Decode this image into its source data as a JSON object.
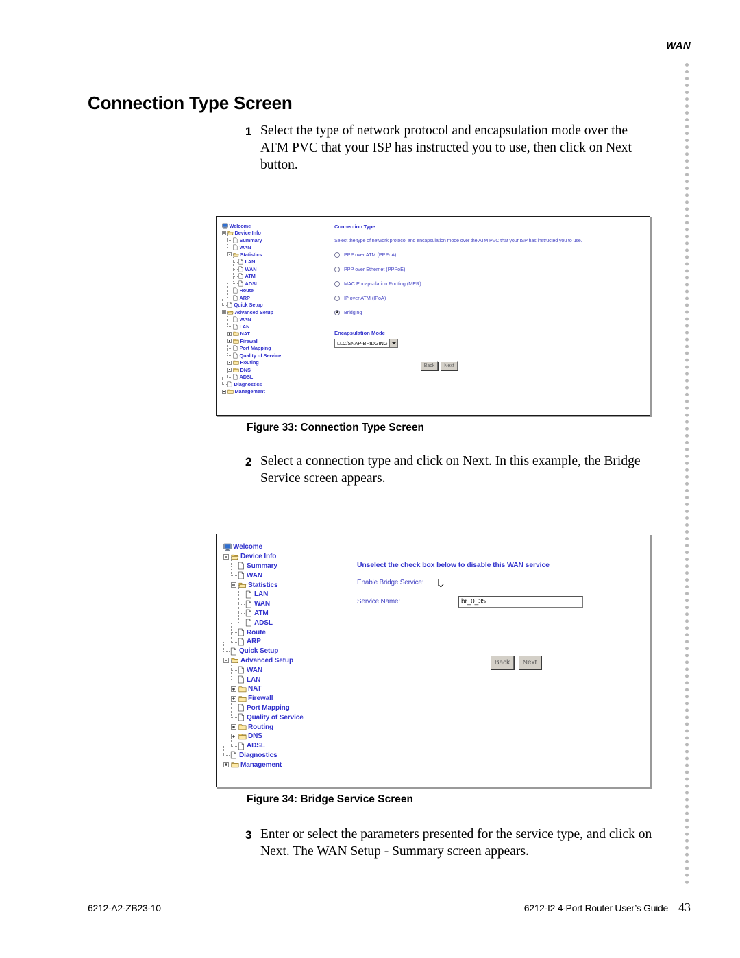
{
  "header": {
    "running_head": "WAN"
  },
  "page_title": "Connection Type Screen",
  "steps": [
    {
      "number": "1",
      "text": "Select the type of network protocol and encapsulation mode over the ATM PVC that your ISP has instructed you to use, then click on Next button."
    },
    {
      "number": "2",
      "text": "Select a connection type and click on Next. In this example, the Bridge Service screen appears."
    },
    {
      "number": "3",
      "text": "Enter or select the parameters presented for the service type, and click on Next. The WAN Setup - Summary screen appears."
    }
  ],
  "figures": [
    {
      "caption": "Figure 33: Connection Type Screen"
    },
    {
      "caption": "Figure 34: Bridge Service Screen"
    }
  ],
  "nav_tree": [
    {
      "label": "Welcome",
      "depth": 0,
      "icon": "monitor-icon",
      "expander": "none"
    },
    {
      "label": "Device Info",
      "depth": 1,
      "icon": "folder-open-icon",
      "expander": "minus"
    },
    {
      "label": "Summary",
      "depth": 2,
      "icon": "page-icon",
      "expander": "none"
    },
    {
      "label": "WAN",
      "depth": 2,
      "icon": "page-icon",
      "expander": "none"
    },
    {
      "label": "Statistics",
      "depth": 2,
      "icon": "folder-open-icon",
      "expander": "minus"
    },
    {
      "label": "LAN",
      "depth": 3,
      "icon": "page-icon",
      "expander": "none"
    },
    {
      "label": "WAN",
      "depth": 3,
      "icon": "page-icon",
      "expander": "none"
    },
    {
      "label": "ATM",
      "depth": 3,
      "icon": "page-icon",
      "expander": "none"
    },
    {
      "label": "ADSL",
      "depth": 3,
      "icon": "page-icon",
      "expander": "none"
    },
    {
      "label": "Route",
      "depth": 2,
      "icon": "page-icon",
      "expander": "none"
    },
    {
      "label": "ARP",
      "depth": 2,
      "icon": "page-icon",
      "expander": "none"
    },
    {
      "label": "Quick Setup",
      "depth": 1,
      "icon": "page-icon",
      "expander": "none"
    },
    {
      "label": "Advanced Setup",
      "depth": 1,
      "icon": "folder-open-icon",
      "expander": "minus"
    },
    {
      "label": "WAN",
      "depth": 2,
      "icon": "page-icon",
      "expander": "none"
    },
    {
      "label": "LAN",
      "depth": 2,
      "icon": "page-icon",
      "expander": "none"
    },
    {
      "label": "NAT",
      "depth": 2,
      "icon": "folder-closed-icon",
      "expander": "plus"
    },
    {
      "label": "Firewall",
      "depth": 2,
      "icon": "folder-closed-icon",
      "expander": "plus"
    },
    {
      "label": "Port Mapping",
      "depth": 2,
      "icon": "page-icon",
      "expander": "none"
    },
    {
      "label": "Quality of Service",
      "depth": 2,
      "icon": "page-icon",
      "expander": "none"
    },
    {
      "label": "Routing",
      "depth": 2,
      "icon": "folder-closed-icon",
      "expander": "plus"
    },
    {
      "label": "DNS",
      "depth": 2,
      "icon": "folder-closed-icon",
      "expander": "plus"
    },
    {
      "label": "ADSL",
      "depth": 2,
      "icon": "page-icon",
      "expander": "none"
    },
    {
      "label": "Diagnostics",
      "depth": 1,
      "icon": "page-icon",
      "expander": "none"
    },
    {
      "label": "Management",
      "depth": 1,
      "icon": "folder-closed-icon",
      "expander": "plus"
    }
  ],
  "connection_type_panel": {
    "heading": "Connection Type",
    "description": "Select the type of network protocol and encapsulation mode over the ATM PVC that your ISP has instructed you to use.",
    "options": [
      {
        "label": "PPP over ATM (PPPoA)",
        "selected": false
      },
      {
        "label": "PPP over Ethernet (PPPoE)",
        "selected": false
      },
      {
        "label": "MAC Encapsulation Routing (MER)",
        "selected": false
      },
      {
        "label": "IP over ATM (IPoA)",
        "selected": false
      },
      {
        "label": "Bridging",
        "selected": true
      }
    ],
    "encapsulation_label": "Encapsulation Mode",
    "encapsulation_value": "LLC/SNAP-BRIDGING",
    "buttons": {
      "back": "Back",
      "next": "Next"
    }
  },
  "bridge_service_panel": {
    "heading": "Unselect the check box below to disable this WAN service",
    "enable_label": "Enable Bridge Service:",
    "enable_checked": true,
    "service_name_label": "Service Name:",
    "service_name_value": "br_0_35",
    "buttons": {
      "back": "Back",
      "next": "Next"
    }
  },
  "footer": {
    "doc_number": "6212-A2-ZB23-10",
    "guide_title": "6212-I2 4-Port Router User’s Guide",
    "page_number": "43"
  },
  "colors": {
    "link_blue": "#3333cc",
    "text_blue": "#4747c4",
    "button_face": "#d4d0c8",
    "folder_yellow": "#f5d76b"
  }
}
